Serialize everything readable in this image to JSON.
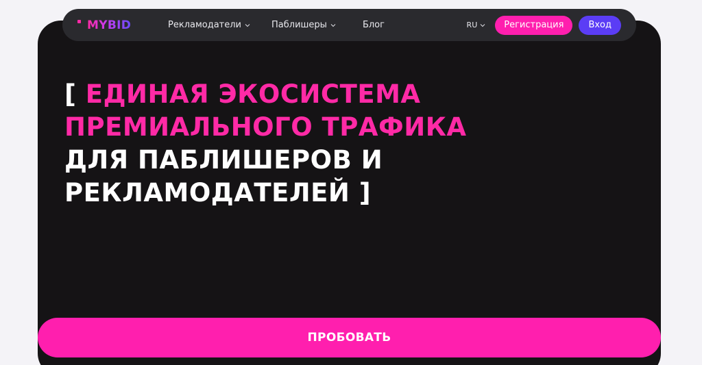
{
  "brand": {
    "logo_text": "MYBID",
    "colors": {
      "pink": "#ff1fae",
      "violet": "#5b3df5",
      "dark": "#151315",
      "nav": "#2a2a2e"
    }
  },
  "nav": {
    "items": [
      {
        "label": "Рекламодатели",
        "has_dropdown": true
      },
      {
        "label": "Паблишеры",
        "has_dropdown": true
      },
      {
        "label": "Блог",
        "has_dropdown": false
      }
    ],
    "language": "RU",
    "register_label": "Регистрация",
    "login_label": "Вход"
  },
  "hero": {
    "line1_open": "[ ",
    "line1": "ЕДИНАЯ ЭКОСИСТЕМА",
    "line2": "ПРЕМИАЛЬНОГО ТРАФИКА",
    "line3": "ДЛЯ ПАБЛИШЕРОВ И",
    "line4": "РЕКЛАМОДАТЕЛЕЙ ]",
    "cta_label": "ПРОБОВАТЬ"
  }
}
